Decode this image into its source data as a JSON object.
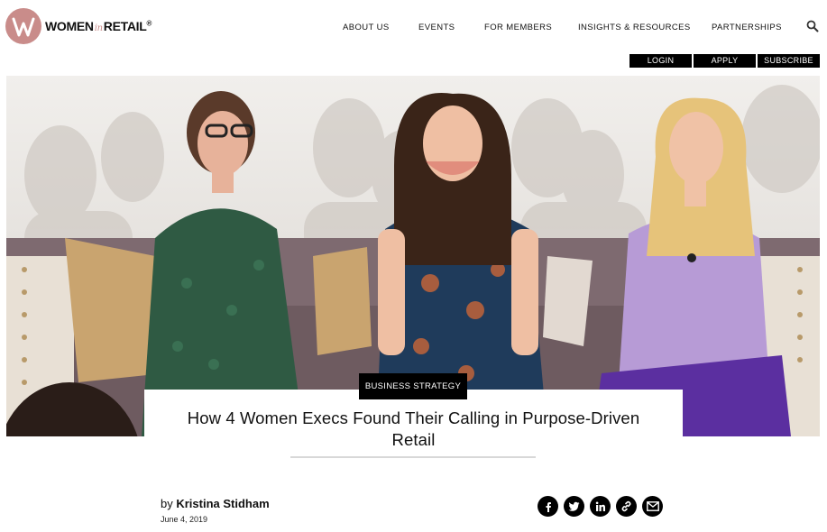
{
  "header": {
    "logo": {
      "brand_main": "WOMEN",
      "brand_in": "in",
      "brand_end": "RETAIL",
      "brand_mark": "®",
      "accent_color": "#c98c8a"
    },
    "nav": [
      "ABOUT US",
      "EVENTS",
      "FOR MEMBERS",
      "INSIGHTS & RESOURCES",
      "PARTNERSHIPS"
    ],
    "search_icon": "search-icon",
    "account": {
      "login": "LOGIN",
      "apply": "APPLY",
      "subscribe": "SUBSCRIBE"
    }
  },
  "article": {
    "category": "BUSINESS STRATEGY",
    "title": "How 4 Women Execs Found Their Calling in Purpose-Driven Retail",
    "by": "by",
    "author": "Kristina Stidham",
    "date": "June 4, 2019",
    "share_icons": [
      "facebook-icon",
      "twitter-icon",
      "linkedin-icon",
      "link-icon",
      "email-icon"
    ]
  }
}
